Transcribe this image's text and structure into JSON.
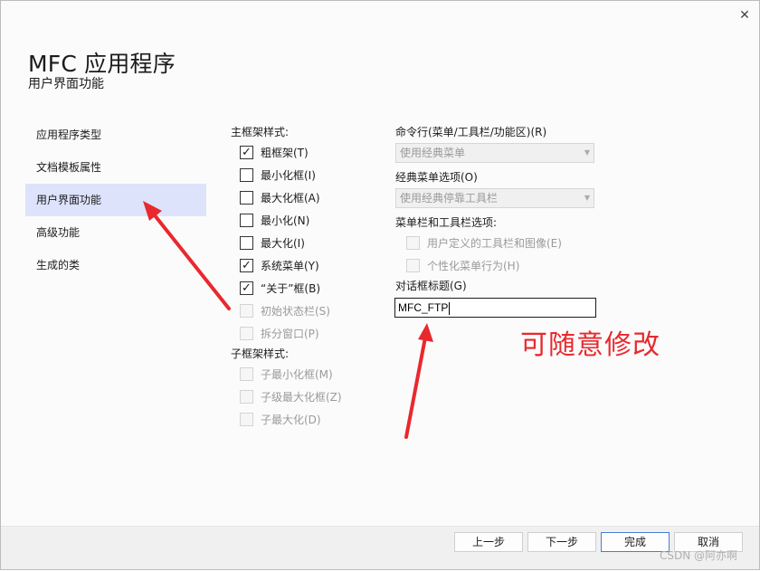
{
  "window": {
    "title": "MFC 应用程序",
    "subtitle": "用户界面功能",
    "close_glyph": "✕"
  },
  "sidebar": {
    "items": [
      {
        "label": "应用程序类型"
      },
      {
        "label": "文档模板属性"
      },
      {
        "label": "用户界面功能",
        "selected": true
      },
      {
        "label": "高级功能"
      },
      {
        "label": "生成的类"
      }
    ]
  },
  "main_frame": {
    "label": "主框架样式:",
    "options": [
      {
        "label": "粗框架(T)",
        "checked": true,
        "enabled": true
      },
      {
        "label": "最小化框(I)",
        "checked": false,
        "enabled": true
      },
      {
        "label": "最大化框(A)",
        "checked": false,
        "enabled": true
      },
      {
        "label": "最小化(N)",
        "checked": false,
        "enabled": true
      },
      {
        "label": "最大化(I)",
        "checked": false,
        "enabled": true
      },
      {
        "label": "系统菜单(Y)",
        "checked": true,
        "enabled": true
      },
      {
        "label": "“关于”框(B)",
        "checked": true,
        "enabled": true
      },
      {
        "label": "初始状态栏(S)",
        "checked": false,
        "enabled": false
      },
      {
        "label": "拆分窗口(P)",
        "checked": false,
        "enabled": false
      }
    ]
  },
  "child_frame": {
    "label": "子框架样式:",
    "options": [
      {
        "label": "子最小化框(M)",
        "checked": false,
        "enabled": false
      },
      {
        "label": "子级最大化框(Z)",
        "checked": false,
        "enabled": false
      },
      {
        "label": "子最大化(D)",
        "checked": false,
        "enabled": false
      }
    ]
  },
  "command_bar": {
    "label": "命令行(菜单/工具栏/功能区)(R)",
    "value": "使用经典菜单"
  },
  "classic_menu": {
    "label": "经典菜单选项(O)",
    "value": "使用经典停靠工具栏"
  },
  "menubar_toolbar": {
    "label": "菜单栏和工具栏选项:",
    "options": [
      {
        "label": "用户定义的工具栏和图像(E)",
        "checked": false,
        "enabled": false
      },
      {
        "label": "个性化菜单行为(H)",
        "checked": false,
        "enabled": false
      }
    ]
  },
  "dialog_title": {
    "label": "对话框标题(G)",
    "value": "MFC_FTP"
  },
  "annotation": {
    "text": "可随意修改",
    "color": "#e8292e"
  },
  "buttons": {
    "prev": "上一步",
    "next": "下一步",
    "finish": "完成",
    "cancel": "取消"
  },
  "watermark": "CSDN @阿亦啊",
  "colors": {
    "selected_nav_bg": "#dde3fb",
    "arrow": "#e8292e"
  }
}
